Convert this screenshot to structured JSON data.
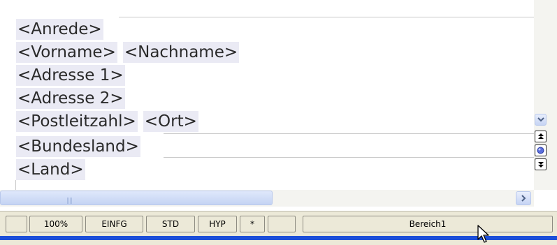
{
  "document": {
    "lines": [
      {
        "fields": [
          "<Anrede>"
        ]
      },
      {
        "fields": [
          "<Vorname>",
          "<Nachname>"
        ]
      },
      {
        "fields": [
          "<Adresse 1>"
        ]
      },
      {
        "fields": [
          "<Adresse 2>"
        ]
      },
      {
        "fields": [
          "<Postleitzahl>",
          "<Ort>"
        ]
      },
      {
        "fields": [
          "<Bundesland>"
        ]
      },
      {
        "fields": [
          "<Land>"
        ]
      }
    ]
  },
  "statusbar": {
    "zoom": "100%",
    "insert_mode": "EINFG",
    "selection_mode": "STD",
    "hyperlink_mode": "HYP",
    "modified": "*",
    "section": "Bereich1"
  },
  "icons": {
    "scroll_down": "chevron-down-icon",
    "prev_object": "double-up-icon",
    "navigator": "circle-icon",
    "next_object": "double-down-icon",
    "scroll_right": "chevron-right-icon",
    "cursor": "mouse-pointer-icon"
  },
  "colors": {
    "field_background": "#eaeaf4",
    "status_bar": "#ece9d8",
    "accent_blue": "#1c4fd9"
  }
}
